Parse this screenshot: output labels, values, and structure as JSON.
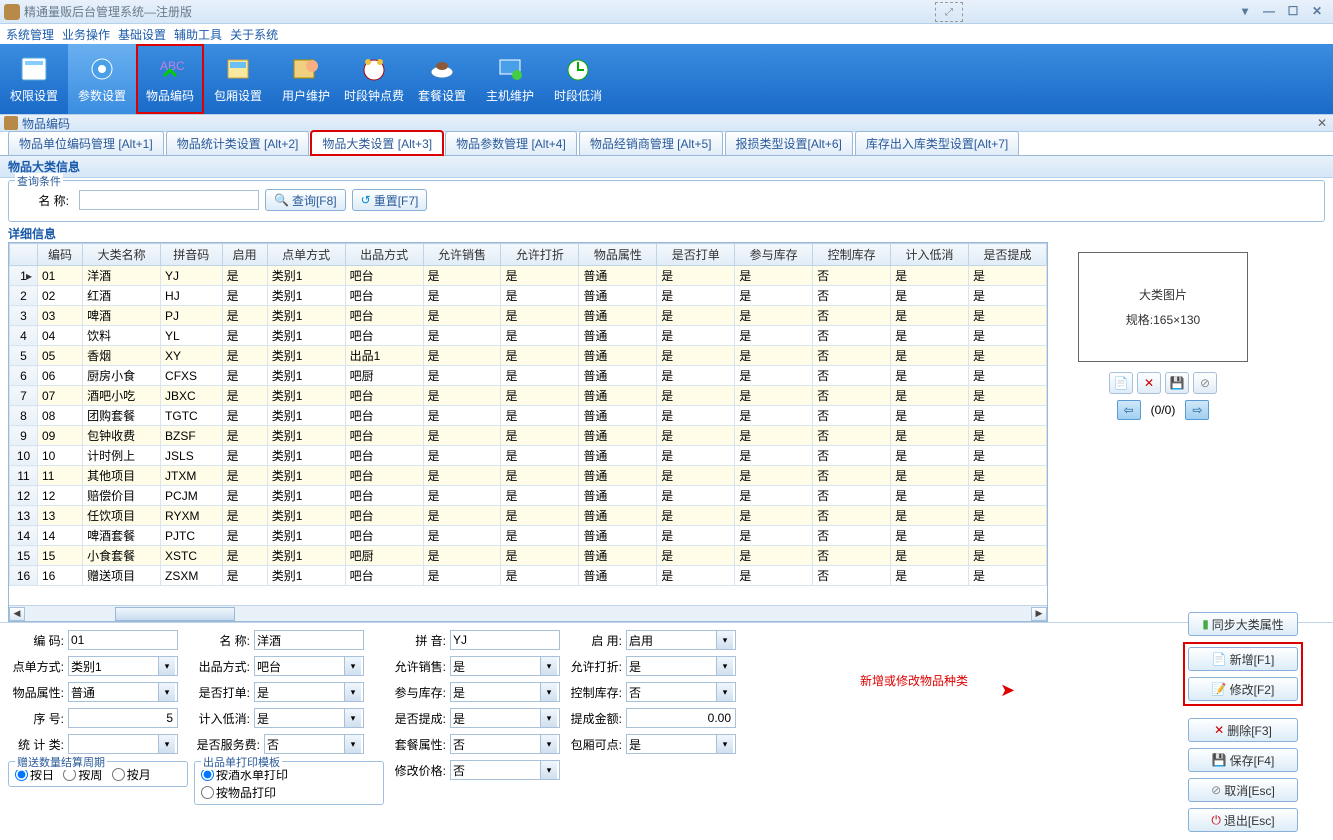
{
  "window": {
    "title": "精通量贩后台管理系统—注册版"
  },
  "menu": [
    "系统管理",
    "业务操作",
    "基础设置",
    "辅助工具",
    "关于系统"
  ],
  "toolbar": [
    {
      "label": "权限设置"
    },
    {
      "label": "参数设置"
    },
    {
      "label": "物品编码"
    },
    {
      "label": "包厢设置"
    },
    {
      "label": "用户维护"
    },
    {
      "label": "时段钟点费"
    },
    {
      "label": "套餐设置"
    },
    {
      "label": "主机维护"
    },
    {
      "label": "时段低消"
    }
  ],
  "section": {
    "title": "物品编码"
  },
  "tabs": [
    "物品单位编码管理 [Alt+1]",
    "物品统计类设置 [Alt+2]",
    "物品大类设置 [Alt+3]",
    "物品参数管理 [Alt+4]",
    "物品经销商管理 [Alt+5]",
    "报损类型设置[Alt+6]",
    "库存出入库类型设置[Alt+7]"
  ],
  "panel_title": "物品大类信息",
  "query": {
    "group_title": "查询条件",
    "label": "名    称:",
    "search": "查询[F8]",
    "reset": "重置[F7]"
  },
  "detail_title": "详细信息",
  "columns": [
    "编码",
    "大类名称",
    "拼音码",
    "启用",
    "点单方式",
    "出品方式",
    "允许销售",
    "允许打折",
    "物品属性",
    "是否打单",
    "参与库存",
    "控制库存",
    "计入低消",
    "是否提成"
  ],
  "rows": [
    [
      "01",
      "洋酒",
      "YJ",
      "是",
      "类别1",
      "吧台",
      "是",
      "是",
      "普通",
      "是",
      "是",
      "否",
      "是",
      "是"
    ],
    [
      "02",
      "红酒",
      "HJ",
      "是",
      "类别1",
      "吧台",
      "是",
      "是",
      "普通",
      "是",
      "是",
      "否",
      "是",
      "是"
    ],
    [
      "03",
      "啤酒",
      "PJ",
      "是",
      "类别1",
      "吧台",
      "是",
      "是",
      "普通",
      "是",
      "是",
      "否",
      "是",
      "是"
    ],
    [
      "04",
      "饮料",
      "YL",
      "是",
      "类别1",
      "吧台",
      "是",
      "是",
      "普通",
      "是",
      "是",
      "否",
      "是",
      "是"
    ],
    [
      "05",
      "香烟",
      "XY",
      "是",
      "类别1",
      "出品1",
      "是",
      "是",
      "普通",
      "是",
      "是",
      "否",
      "是",
      "是"
    ],
    [
      "06",
      "厨房小食",
      "CFXS",
      "是",
      "类别1",
      "吧厨",
      "是",
      "是",
      "普通",
      "是",
      "是",
      "否",
      "是",
      "是"
    ],
    [
      "07",
      "酒吧小吃",
      "JBXC",
      "是",
      "类别1",
      "吧台",
      "是",
      "是",
      "普通",
      "是",
      "是",
      "否",
      "是",
      "是"
    ],
    [
      "08",
      "团购套餐",
      "TGTC",
      "是",
      "类别1",
      "吧台",
      "是",
      "是",
      "普通",
      "是",
      "是",
      "否",
      "是",
      "是"
    ],
    [
      "09",
      "包钟收费",
      "BZSF",
      "是",
      "类别1",
      "吧台",
      "是",
      "是",
      "普通",
      "是",
      "是",
      "否",
      "是",
      "是"
    ],
    [
      "10",
      "计时例上",
      "JSLS",
      "是",
      "类别1",
      "吧台",
      "是",
      "是",
      "普通",
      "是",
      "是",
      "否",
      "是",
      "是"
    ],
    [
      "11",
      "其他项目",
      "JTXM",
      "是",
      "类别1",
      "吧台",
      "是",
      "是",
      "普通",
      "是",
      "是",
      "否",
      "是",
      "是"
    ],
    [
      "12",
      "赔偿价目",
      "PCJM",
      "是",
      "类别1",
      "吧台",
      "是",
      "是",
      "普通",
      "是",
      "是",
      "否",
      "是",
      "是"
    ],
    [
      "13",
      "任饮项目",
      "RYXM",
      "是",
      "类别1",
      "吧台",
      "是",
      "是",
      "普通",
      "是",
      "是",
      "否",
      "是",
      "是"
    ],
    [
      "14",
      "啤酒套餐",
      "PJTC",
      "是",
      "类别1",
      "吧台",
      "是",
      "是",
      "普通",
      "是",
      "是",
      "否",
      "是",
      "是"
    ],
    [
      "15",
      "小食套餐",
      "XSTC",
      "是",
      "类别1",
      "吧厨",
      "是",
      "是",
      "普通",
      "是",
      "是",
      "否",
      "是",
      "是"
    ],
    [
      "16",
      "赠送项目",
      "ZSXM",
      "是",
      "类别1",
      "吧台",
      "是",
      "是",
      "普通",
      "是",
      "是",
      "否",
      "是",
      "是"
    ]
  ],
  "image_panel": {
    "title": "大类图片",
    "spec": "规格:165×130",
    "counter": "(0/0)"
  },
  "form": {
    "f1": {
      "l": "编    码:",
      "v": "01"
    },
    "f2": {
      "l": "点单方式:",
      "v": "类别1"
    },
    "f3": {
      "l": "物品属性:",
      "v": "普通"
    },
    "f4": {
      "l": "序    号:",
      "v": "5"
    },
    "f5": {
      "l": "统 计 类:",
      "v": ""
    },
    "g1": {
      "t": "赠送数量结算周期",
      "a": "按日",
      "b": "按周",
      "c": "按月"
    },
    "f6": {
      "l": "名    称:",
      "v": "洋酒"
    },
    "f7": {
      "l": "出品方式:",
      "v": "吧台"
    },
    "f8": {
      "l": "是否打单:",
      "v": "是"
    },
    "f9": {
      "l": "计入低消:",
      "v": "是"
    },
    "f10": {
      "l": "是否服务费:",
      "v": "否"
    },
    "g2": {
      "t": "出品单打印模板",
      "a": "按酒水单打印",
      "b": "按物品打印"
    },
    "f11": {
      "l": "拼    音:",
      "v": "YJ"
    },
    "f12": {
      "l": "允许销售:",
      "v": "是"
    },
    "f13": {
      "l": "参与库存:",
      "v": "是"
    },
    "f14": {
      "l": "是否提成:",
      "v": "是"
    },
    "f15": {
      "l": "套餐属性:",
      "v": "否"
    },
    "f16": {
      "l": "修改价格:",
      "v": "否"
    },
    "f17": {
      "l": "启    用:",
      "v": "启用"
    },
    "f18": {
      "l": "允许打折:",
      "v": "是"
    },
    "f19": {
      "l": "控制库存:",
      "v": "否"
    },
    "f20": {
      "l": "提成金额:",
      "v": "0.00"
    },
    "f21": {
      "l": "包厢可点:",
      "v": "是"
    }
  },
  "annotation": "新增或修改物品种类",
  "rbtns": {
    "sync": "同步大类属性",
    "add": "新增[F1]",
    "edit": "修改[F2]",
    "del": "删除[F3]",
    "save": "保存[F4]",
    "cancel": "取消[Esc]",
    "exit": "退出[Esc]"
  }
}
